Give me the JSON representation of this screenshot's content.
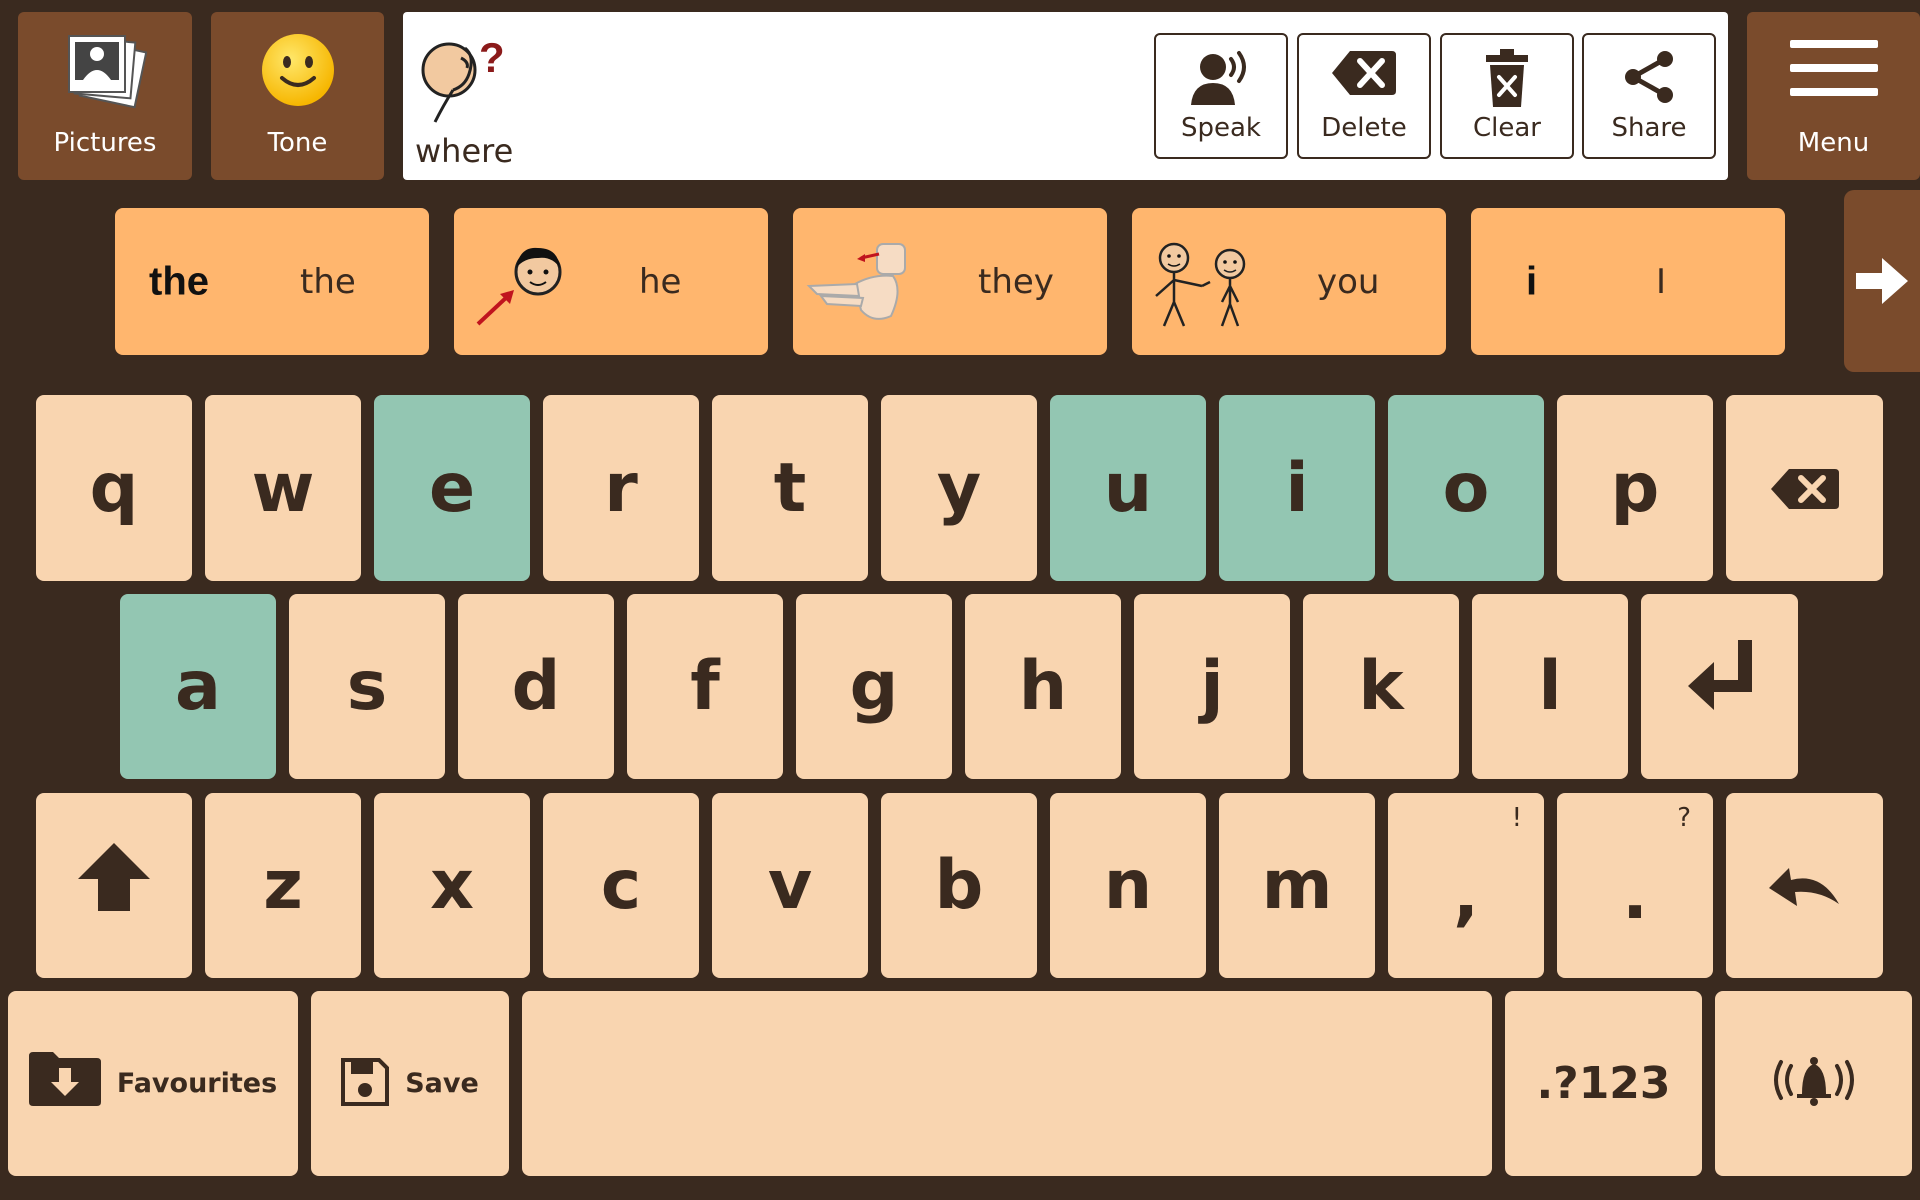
{
  "topbar": {
    "pictures_label": "Pictures",
    "tone_label": "Tone",
    "menu_label": "Menu"
  },
  "message": {
    "word": "where",
    "symbol_mark": "?"
  },
  "actions": {
    "speak": "Speak",
    "delete": "Delete",
    "clear": "Clear",
    "share": "Share"
  },
  "suggestions": [
    {
      "symbol_text": "the",
      "word": "the"
    },
    {
      "symbol_text": "",
      "word": "he"
    },
    {
      "symbol_text": "",
      "word": "they"
    },
    {
      "symbol_text": "",
      "word": "you"
    },
    {
      "symbol_text": "i",
      "word": "I"
    }
  ],
  "keys": {
    "row1": [
      "q",
      "w",
      "e",
      "r",
      "t",
      "y",
      "u",
      "i",
      "o",
      "p"
    ],
    "row2": [
      "a",
      "s",
      "d",
      "f",
      "g",
      "h",
      "j",
      "k",
      "l"
    ],
    "row3": [
      "z",
      "x",
      "c",
      "v",
      "b",
      "n",
      "m",
      ",",
      "."
    ],
    "comma_alt": "!",
    "period_alt": "?",
    "favourites": "Favourites",
    "save": "Save",
    "numbers": ".?123"
  },
  "colors": {
    "background": "#3a2a1f",
    "topbar_button": "#7a4b2c",
    "suggestion": "#ffb66e",
    "key": "#f9d5b0",
    "vowel_key": "#93c6b2"
  },
  "icons": {
    "pictures": "photo-stack-icon",
    "tone": "smiley-icon",
    "speak": "speaking-head-icon",
    "delete": "backspace-icon",
    "clear": "trash-icon",
    "share": "share-icon",
    "menu": "hamburger-icon",
    "next": "arrow-right-icon",
    "shift": "arrow-up-icon",
    "enter": "enter-icon",
    "undo": "undo-icon",
    "favourites": "folder-download-icon",
    "save": "floppy-icon",
    "alert": "bell-icon"
  }
}
